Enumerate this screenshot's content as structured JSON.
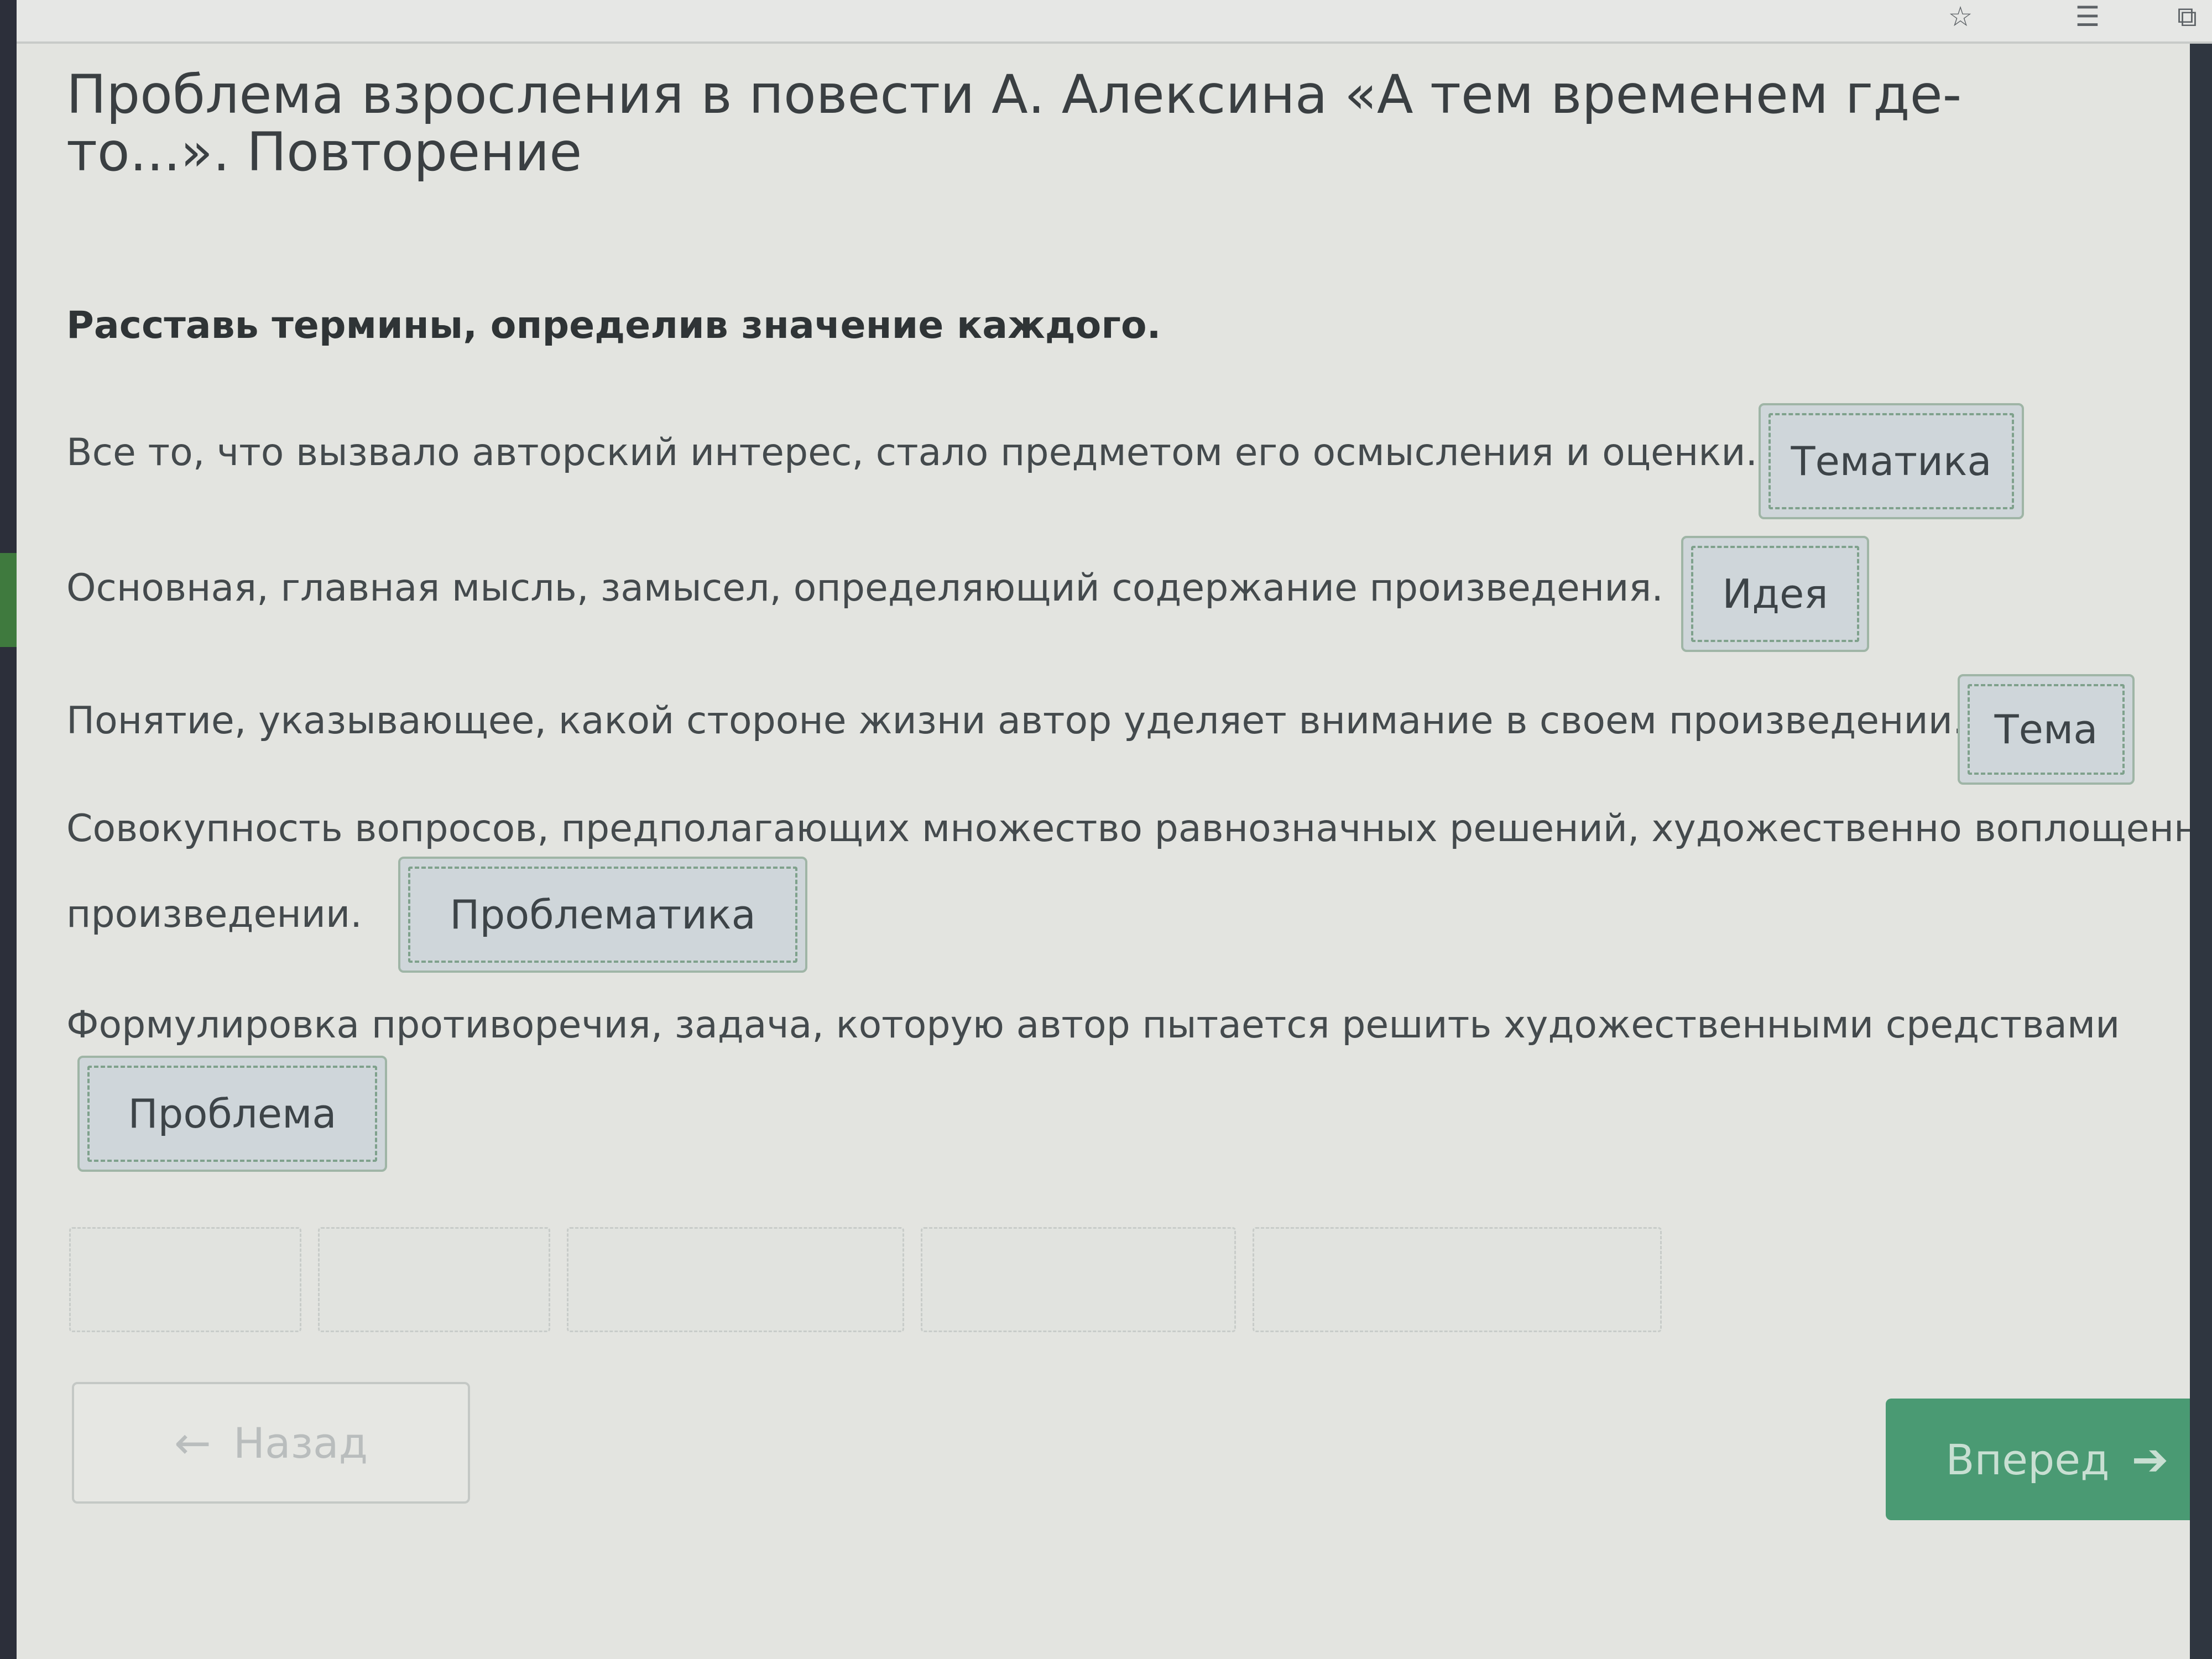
{
  "browser": {
    "star_icon": "☆",
    "reading_list_icon": "☰",
    "collections_icon": "⧉"
  },
  "lesson": {
    "title": "Проблема взросления в повести А. Алексина «А тем временем где-то...». Повторение",
    "instruction": "Расставь термины, определив значение каждого."
  },
  "definitions": [
    {
      "text": "Все то, что вызвало авторский интерес, стало предметом его осмысления и оценки.",
      "answer": "Тематика"
    },
    {
      "text": "Основная, главная мысль, замысел, определяющий содержание произведения.",
      "answer": "Идея"
    },
    {
      "text": "Понятие, указывающее, какой стороне жизни автор уделяет внимание в своем произведении.",
      "answer": "Тема"
    },
    {
      "text_line1": "Совокупность вопросов, предполагающих множество равнозначных решений, художественно воплощенных",
      "text_line2": "произведении.",
      "answer": "Проблематика"
    },
    {
      "text": "Формулировка противоречия, задача, которую автор пытается решить художественными средствами",
      "answer": "Проблема"
    }
  ],
  "navigation": {
    "back_label": "Назад",
    "back_icon": "←",
    "next_label": "Вперед",
    "next_icon": "➔"
  },
  "colors": {
    "next_button": "#4a9a73",
    "chip_background": "#cfd6da",
    "chip_border": "#7fa18c"
  }
}
